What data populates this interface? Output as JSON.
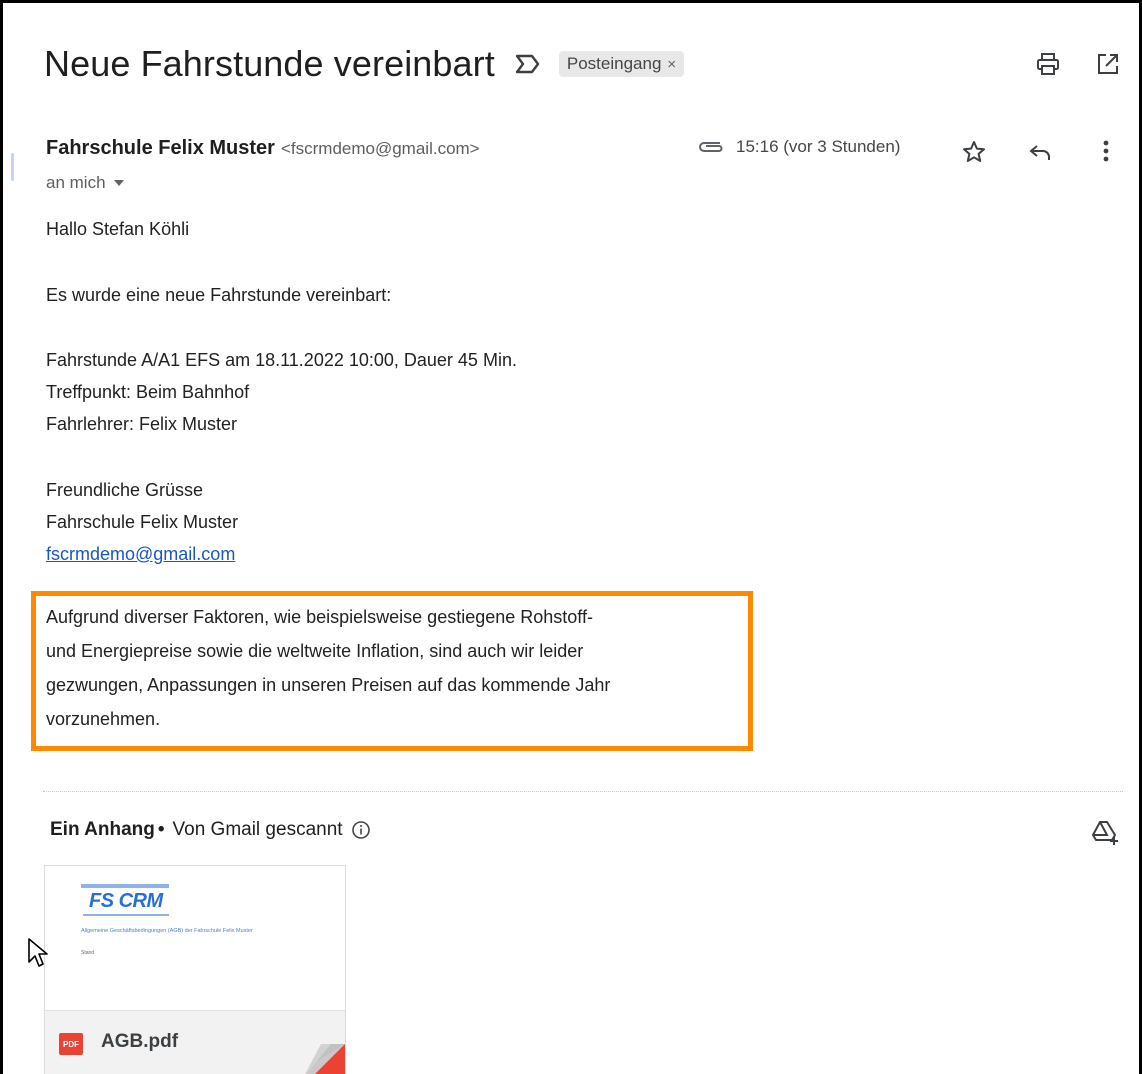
{
  "email": {
    "subject": "Neue Fahrstunde vereinbart",
    "label": "Posteingang",
    "label_close": "×",
    "sender_name": "Fahrschule Felix Muster",
    "sender_email": "<fscrmdemo@gmail.com>",
    "recipient": "an mich",
    "time": "15:16 (vor 3 Stunden)",
    "body": {
      "greeting": "Hallo Stefan Köhli",
      "intro": "Es wurde eine neue Fahrstunde vereinbart:",
      "lesson": "Fahrstunde A/A1 EFS am 18.11.2022 10:00, Dauer 45 Min.",
      "meeting_point": "Treffpunkt: Beim Bahnhof",
      "instructor": "Fahrlehrer: Felix Muster",
      "closing": "Freundliche Grüsse",
      "signature_name": "Fahrschule Felix Muster",
      "signature_email": "fscrmdemo@gmail.com",
      "notice_lines": [
        "Aufgrund diverser Faktoren, wie beispielsweise gestiegene Rohstoff-",
        "und Energiepreise sowie die weltweite Inflation, sind auch wir leider",
        "gezwungen, Anpassungen in unseren Preisen auf das kommende Jahr",
        "vorzunehmen."
      ]
    }
  },
  "attachments": {
    "heading": "Ein Anhang",
    "separator": "•",
    "scan_note": "Von Gmail gescannt",
    "file": {
      "name": "AGB.pdf",
      "type_badge": "PDF",
      "preview_logo": "FS CRM",
      "preview_title": "Allgemeine Geschäftsbedingungen (AGB) der Fahrschule Felix Muster",
      "preview_sub": "Stand"
    }
  },
  "icons": {
    "important": "important-marker-icon",
    "print": "print-icon",
    "open_new_window": "open-in-new-window-icon",
    "attachment": "paperclip-icon",
    "star": "star-icon",
    "reply": "reply-icon",
    "more": "more-vert-icon",
    "info": "info-icon",
    "add_to_drive": "add-to-drive-icon",
    "cursor": "mouse-pointer-icon"
  },
  "colors": {
    "highlight_border": "#ff8a00",
    "link": "#1a56c8",
    "pdf_red": "#ea4335"
  }
}
